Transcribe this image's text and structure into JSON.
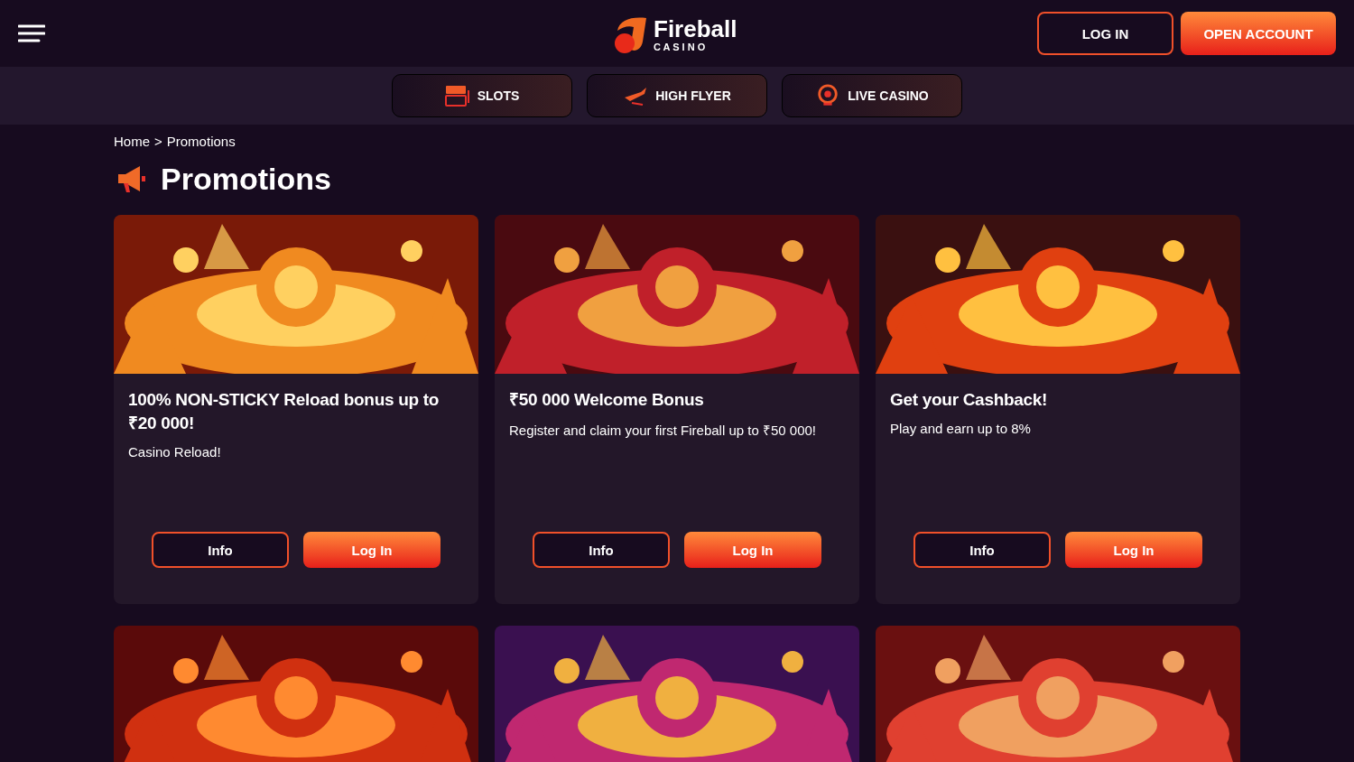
{
  "header": {
    "logo": {
      "name": "Fireball",
      "tagline": "C A S I N O"
    },
    "login": "LOG IN",
    "open_account": "OPEN ACCOUNT"
  },
  "nav": [
    {
      "label": "SLOTS",
      "kind": "slots"
    },
    {
      "label": "HIGH FLYER",
      "kind": "plane"
    },
    {
      "label": "LIVE CASINO",
      "kind": "wheel"
    }
  ],
  "breadcrumb": {
    "home": "Home",
    "separator": ">",
    "current": "Promotions"
  },
  "title": "Promotions",
  "promotions": [
    {
      "kind": "offer",
      "title": "100% NON-STICKY Reload bonus up to ₹20 000!",
      "text": "Casino Reload!",
      "info": "Info",
      "action": "Log In"
    },
    {
      "kind": "offer",
      "title": "₹50 000 Welcome Bonus",
      "text": "Register and claim your first Fireball up to ₹50 000!",
      "info": "Info",
      "action": "Log In"
    },
    {
      "kind": "offer",
      "title": "Get your Cashback!",
      "text": "Play and earn up to 8%",
      "info": "Info",
      "action": "Log In"
    },
    {
      "kind": "picture"
    },
    {
      "kind": "picture"
    },
    {
      "kind": "picture"
    }
  ]
}
